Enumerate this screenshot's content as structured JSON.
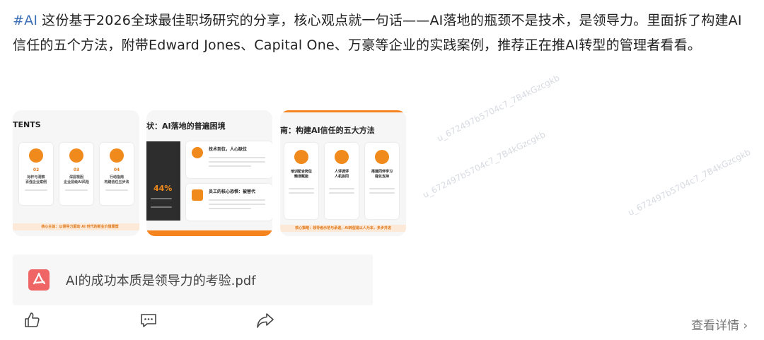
{
  "post": {
    "hashtag": "#AI",
    "text": "这份基于2026全球最佳职场研究的分享，核心观点就一句话——AI落地的瓶颈不是技术，是领导力。里面拆了构建AI信任的五个方法，附带Edward Jones、Capital One、万豪等企业的实践案例，推荐正在推AI转型的管理者看看。"
  },
  "thumbnails": [
    {
      "title": "TENTS",
      "cards": [
        {
          "num": "02",
          "label": "标杆与洞察\n百强企业案例"
        },
        {
          "num": "03",
          "label": "深层根因\n企业层级AI风险"
        },
        {
          "num": "04",
          "label": "行动指南\n构建信任五步法"
        }
      ],
      "footer": "核心主旨：以领导力驱动 AI 时代的新业价值重塑"
    },
    {
      "title": "状：AI落地的普遍困境",
      "items": [
        {
          "title": "技术到位，人心缺位"
        },
        {
          "title": "员工的核心恐惧：被替代"
        }
      ],
      "stat": "44%"
    },
    {
      "title": "南：构建AI信任的五大方法",
      "cards": [
        {
          "label": "培训配合岗位\n精准赋能"
        },
        {
          "label": "人评调评\n人机协同"
        },
        {
          "label": "搭建同伴学习\n强化支持"
        }
      ],
      "footer": "核心策略：领导者示范与承诺，AI转型是以人为本，多步并进"
    }
  ],
  "watermark": "u_672497b5704c7_7B4kGzcgkb",
  "file": {
    "name": "AI的成功本质是领导力的考验.pdf",
    "icon": "pdf-icon"
  },
  "actions": {
    "like_icon": "thumbs-up-icon",
    "comment_icon": "comment-icon",
    "share_icon": "share-icon",
    "detail_label": "查看详情 ›"
  },
  "colors": {
    "hashtag": "#3b6fb6",
    "accent": "#f08a1c",
    "pdf": "#ef6566"
  }
}
